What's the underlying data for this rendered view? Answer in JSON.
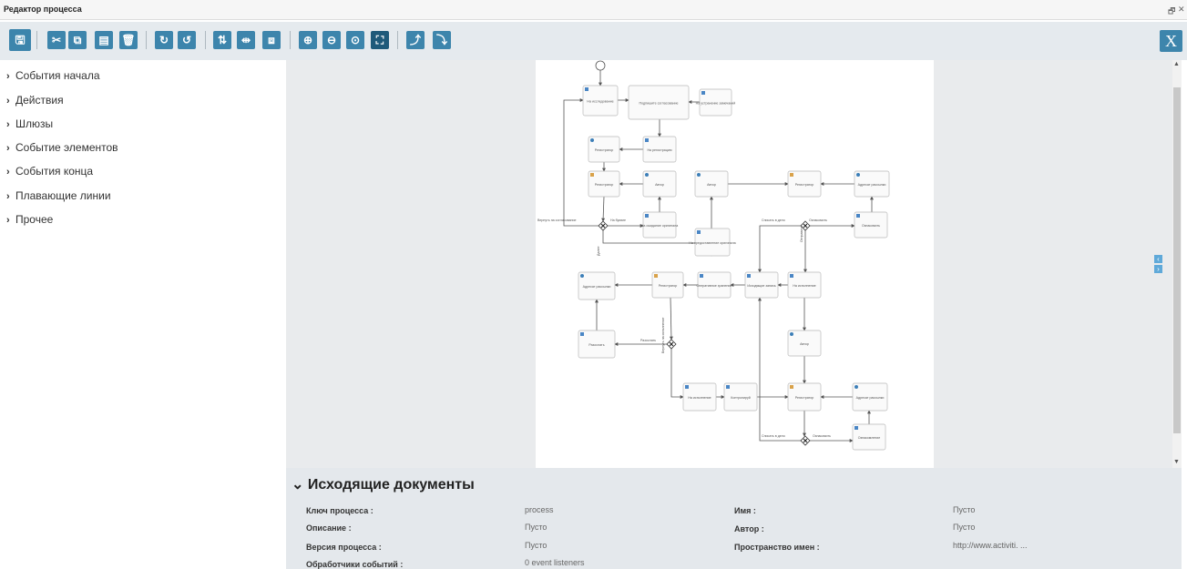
{
  "window": {
    "title": "Редактор процесса",
    "restore_glyph": "🗗",
    "close_glyph": "✕"
  },
  "toolbar": {
    "buttons": [
      {
        "name": "save-button",
        "glyph": "🖫"
      },
      {
        "name": "cut-button",
        "glyph": "✂"
      },
      {
        "name": "copy-button",
        "glyph": "⧉"
      },
      {
        "name": "paste-button",
        "glyph": "▤"
      },
      {
        "name": "delete-button",
        "glyph": "🗑"
      },
      {
        "name": "redo-button",
        "glyph": "↻"
      },
      {
        "name": "undo-button",
        "glyph": "↺"
      },
      {
        "name": "align-vertical-button",
        "glyph": "⇅"
      },
      {
        "name": "align-horizontal-button",
        "glyph": "⇹"
      },
      {
        "name": "same-size-button",
        "glyph": "⧈"
      },
      {
        "name": "zoom-in-button",
        "glyph": "⊕"
      },
      {
        "name": "zoom-out-button",
        "glyph": "⊖"
      },
      {
        "name": "zoom-actual-button",
        "glyph": "⊙"
      },
      {
        "name": "zoom-fit-button",
        "glyph": "⛶"
      },
      {
        "name": "add-bendpoint-button",
        "glyph": "⤴"
      },
      {
        "name": "remove-bendpoint-button",
        "glyph": "⤵"
      }
    ],
    "close_label": "X"
  },
  "palette": {
    "items": [
      {
        "label": "События начала"
      },
      {
        "label": "Действия"
      },
      {
        "label": "Шлюзы"
      },
      {
        "label": "Событие элементов"
      },
      {
        "label": "События конца"
      },
      {
        "label": "Плавающие линии"
      },
      {
        "label": "Прочее"
      }
    ]
  },
  "diagram": {
    "tasks": [
      {
        "id": "t1",
        "label": "На исследование",
        "icon": "doc"
      },
      {
        "id": "t2",
        "label": "Подпишите согласование",
        "icon": "none"
      },
      {
        "id": "t3",
        "label": "На устранение замечаний",
        "icon": "doc"
      },
      {
        "id": "t4",
        "label": "Регистратор",
        "icon": "gear"
      },
      {
        "id": "t5",
        "label": "На регистрацию",
        "icon": "doc"
      },
      {
        "id": "t6",
        "label": "Регистратор",
        "icon": "user"
      },
      {
        "id": "t7",
        "label": "Автор",
        "icon": "gear"
      },
      {
        "id": "t8",
        "label": "Автор",
        "icon": "gear"
      },
      {
        "id": "t9",
        "label": "Регистратор",
        "icon": "user"
      },
      {
        "id": "t10",
        "label": "Адресат рассылки",
        "icon": "gear"
      },
      {
        "id": "t11",
        "label": "На ожидание оригинала",
        "icon": "doc"
      },
      {
        "id": "t12",
        "label": "На предоставление оригинала",
        "icon": "doc"
      },
      {
        "id": "t13",
        "label": "Ознакомить",
        "icon": "doc"
      },
      {
        "id": "t14",
        "label": "Адресат рассылки",
        "icon": "gear"
      },
      {
        "id": "t15",
        "label": "Регистратор",
        "icon": "user"
      },
      {
        "id": "t16",
        "label": "Оперативное хранение",
        "icon": "doc"
      },
      {
        "id": "t17",
        "label": "Исходящие запись",
        "icon": "doc"
      },
      {
        "id": "t18",
        "label": "На исполнение",
        "icon": "doc"
      },
      {
        "id": "t19",
        "label": "Разослать",
        "icon": "doc"
      },
      {
        "id": "t20",
        "label": "Автор",
        "icon": "gear"
      },
      {
        "id": "t21",
        "label": "На исполнение",
        "icon": "doc"
      },
      {
        "id": "t22",
        "label": "Контролируй",
        "icon": "doc"
      },
      {
        "id": "t23",
        "label": "Регистратор",
        "icon": "user"
      },
      {
        "id": "t24",
        "label": "Адресат рассылки",
        "icon": "gear"
      },
      {
        "id": "t25",
        "label": "Ознакомление",
        "icon": "doc"
      }
    ],
    "edge_labels": [
      {
        "id": "e1",
        "text": "Вернуть на согласование"
      },
      {
        "id": "e2",
        "text": "На бумаге"
      },
      {
        "id": "e3",
        "text": "Далее"
      },
      {
        "id": "e4",
        "text": "Списать в дело"
      },
      {
        "id": "e5",
        "text": "Ознакомить"
      },
      {
        "id": "e6",
        "text": "Отправить"
      },
      {
        "id": "e7",
        "text": "Разослать"
      },
      {
        "id": "e8",
        "text": "Вернуть на исполнение"
      },
      {
        "id": "e9",
        "text": "Списать в дело"
      },
      {
        "id": "e10",
        "text": "Ознакомить"
      }
    ]
  },
  "properties": {
    "header": "Исходящие документы",
    "fields": [
      {
        "label": "Ключ процесса :",
        "value": "process"
      },
      {
        "label": "Описание :",
        "value": "Пусто"
      },
      {
        "label": "Версия процесса :",
        "value": "Пусто"
      },
      {
        "label": "Обработчики событий :",
        "value": "0 event listeners"
      },
      {
        "label": "Имя :",
        "value": "Пусто"
      },
      {
        "label": "Автор :",
        "value": "Пусто"
      },
      {
        "label": "Пространство имен :",
        "value": "http://www.activiti. ..."
      }
    ]
  }
}
